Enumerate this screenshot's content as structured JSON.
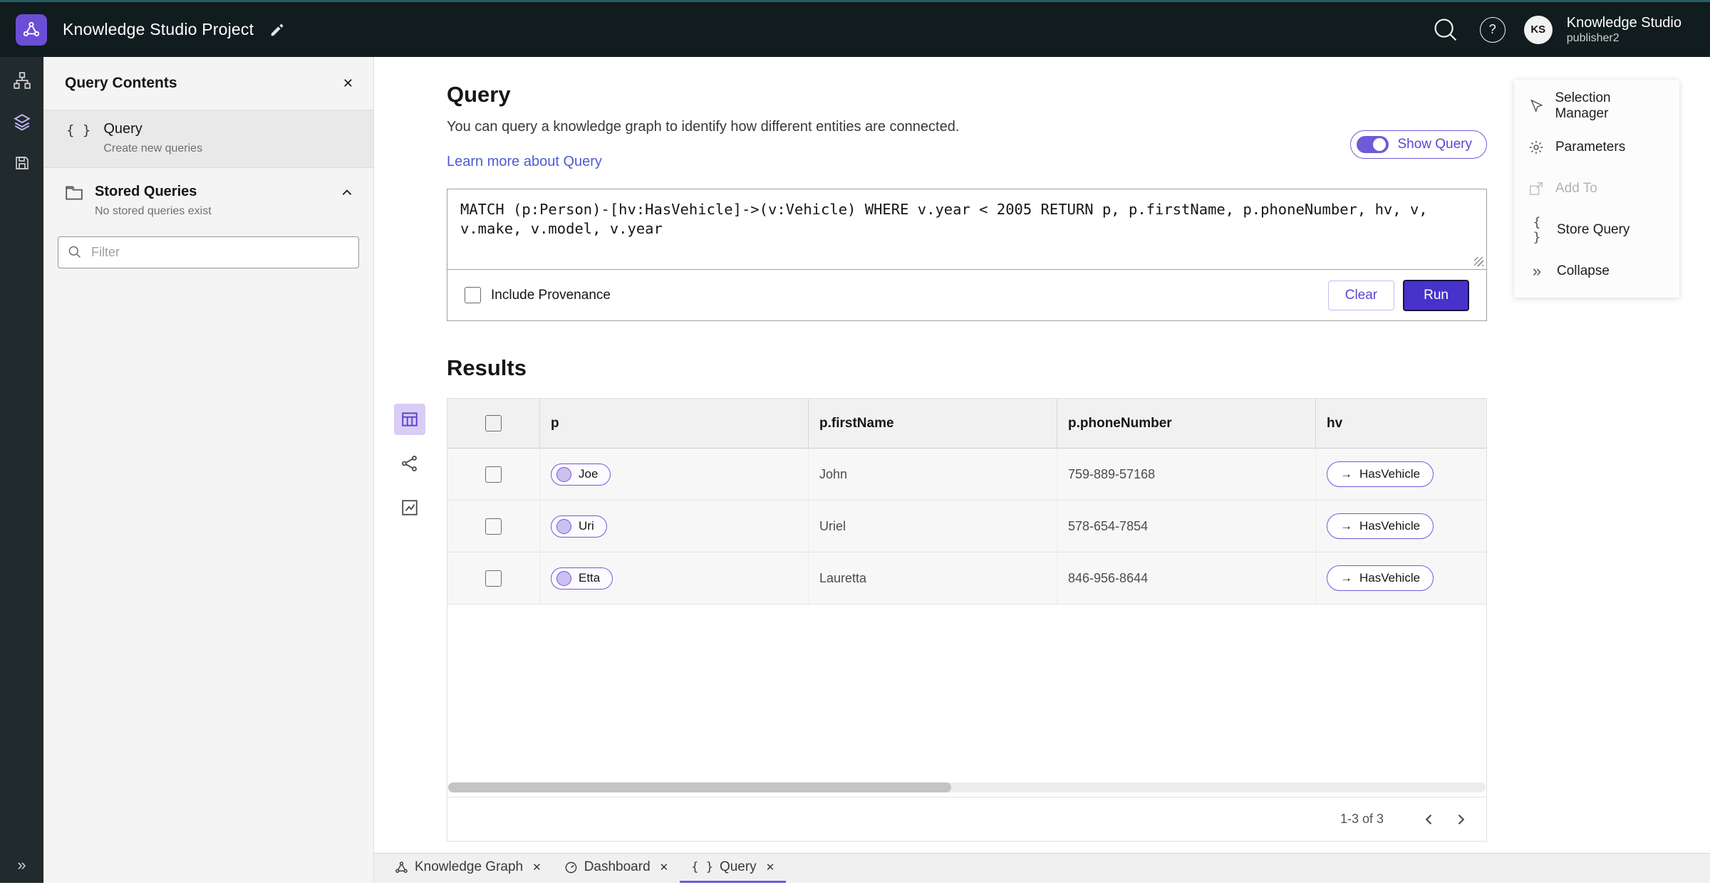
{
  "colors": {
    "accent": "#6f5bd8",
    "run_button": "#4733c9",
    "link": "#4d5bd3",
    "topbar_bg": "#111c1e"
  },
  "glyphs": {
    "close": "✕",
    "collapse": "»",
    "braces": "{ }",
    "arrow": "→",
    "help": "?"
  },
  "topbar": {
    "title": "Knowledge Studio Project",
    "product": "Knowledge Studio",
    "user": "publisher2",
    "avatar_initials": "KS"
  },
  "left_panel": {
    "title": "Query Contents",
    "query_item": {
      "label": "Query",
      "sublabel": "Create new queries"
    },
    "stored_queries": {
      "label": "Stored Queries",
      "sublabel": "No stored queries exist"
    },
    "filter_placeholder": "Filter"
  },
  "query_section": {
    "title": "Query",
    "description": "You can query a knowledge graph to identify how different entities are connected.",
    "learn_more": "Learn more about Query",
    "show_query": "Show Query",
    "query_text": "MATCH (p:Person)-[hv:HasVehicle]->(v:Vehicle) WHERE v.year < 2005 RETURN p, p.firstName, p.phoneNumber, hv, v, v.make, v.model, v.year",
    "include_provenance": "Include Provenance",
    "clear": "Clear",
    "run": "Run"
  },
  "results": {
    "title": "Results",
    "columns": [
      "p",
      "p.firstName",
      "p.phoneNumber",
      "hv"
    ],
    "rows": [
      {
        "p": "Joe",
        "firstName": "John",
        "phoneNumber": "759-889-57168",
        "hv": "HasVehicle"
      },
      {
        "p": "Uri",
        "firstName": "Uriel",
        "phoneNumber": "578-654-7854",
        "hv": "HasVehicle"
      },
      {
        "p": "Etta",
        "firstName": "Lauretta",
        "phoneNumber": "846-956-8644",
        "hv": "HasVehicle"
      }
    ],
    "pagination": "1-3 of 3"
  },
  "right_menu": {
    "selection_manager": "Selection Manager",
    "parameters": "Parameters",
    "add_to": "Add To",
    "store_query": "Store Query",
    "collapse": "Collapse"
  },
  "bottom_tabs": {
    "tab1": "Knowledge Graph",
    "tab2": "Dashboard",
    "tab3": "Query"
  }
}
